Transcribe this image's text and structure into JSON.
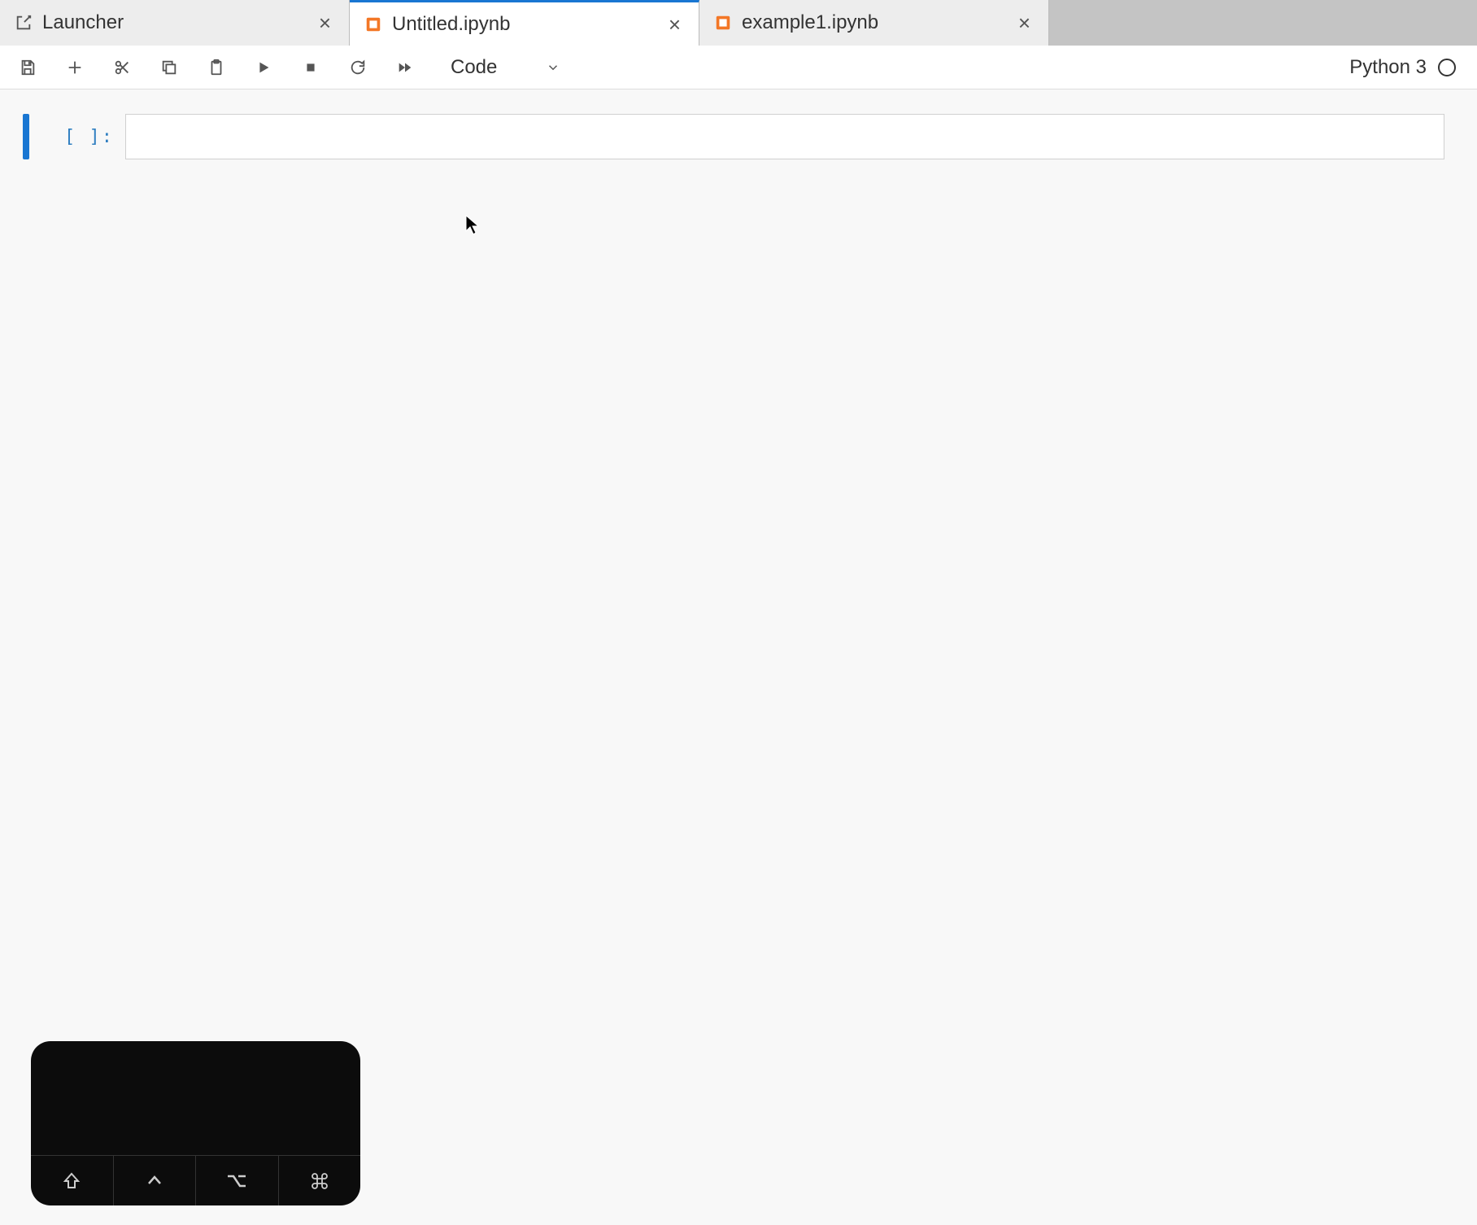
{
  "tabs": [
    {
      "label": "Launcher",
      "type": "launcher"
    },
    {
      "label": "Untitled.ipynb",
      "type": "notebook",
      "active": true
    },
    {
      "label": "example1.ipynb",
      "type": "notebook"
    }
  ],
  "toolbar": {
    "cell_type": "Code"
  },
  "kernel": {
    "name": "Python 3",
    "status": "idle"
  },
  "cell": {
    "prompt": "[ ]:",
    "source": ""
  },
  "keyboard_overlay": {
    "keys": [
      "shift",
      "control",
      "option",
      "command"
    ]
  }
}
